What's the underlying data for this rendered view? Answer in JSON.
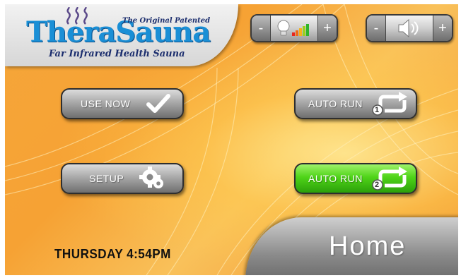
{
  "logo": {
    "brand": "TheraSauna",
    "tagline": "The Original Patented",
    "subtitle": "Far Infrared Health Sauna"
  },
  "controls": {
    "light": {
      "minus": "-",
      "plus": "+",
      "icon": "lightbulb-icon"
    },
    "volume": {
      "minus": "-",
      "plus": "+",
      "icon": "speaker-icon"
    }
  },
  "buttons": {
    "use_now": "USE NOW",
    "setup": "SETUP",
    "auto_run_1": "AUTO RUN",
    "auto_run_1_number": "1",
    "auto_run_2": "AUTO RUN",
    "auto_run_2_number": "2"
  },
  "status": {
    "day_time": "THURSDAY 4:54PM"
  },
  "page": {
    "title": "Home"
  },
  "colors": {
    "background": "#f5a63a",
    "logo_blue": "#1a8fd6",
    "active_button": "#4fd418",
    "button_gray": "#a9a9a9"
  }
}
